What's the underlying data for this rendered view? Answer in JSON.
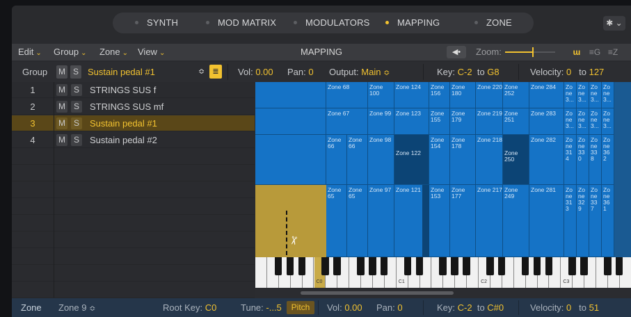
{
  "tabs": [
    {
      "label": "SYNTH",
      "active": false
    },
    {
      "label": "MOD MATRIX",
      "active": false
    },
    {
      "label": "MODULATORS",
      "active": false
    },
    {
      "label": "MAPPING",
      "active": true
    },
    {
      "label": "ZONE",
      "active": false
    }
  ],
  "gear_icon": "gear-icon",
  "menubar": {
    "edit": "Edit",
    "group": "Group",
    "zone": "Zone",
    "view": "View",
    "title": "MAPPING",
    "zoom_label": "Zoom:",
    "zoom_level": 0.55
  },
  "group_row": {
    "label": "Group",
    "m": "M",
    "s": "S",
    "selected": "Sustain pedal #1",
    "vol_label": "Vol:",
    "vol": "0.00",
    "pan_label": "Pan:",
    "pan": "0",
    "output_label": "Output:",
    "output": "Main",
    "key_label": "Key:",
    "key_low": "C-2",
    "key_to": "to",
    "key_high": "G8",
    "vel_label": "Velocity:",
    "vel_low": "0",
    "vel_to": "to",
    "vel_high": "127"
  },
  "groups": [
    {
      "num": "1",
      "name": "STRINGS SUS f"
    },
    {
      "num": "2",
      "name": "STRINGS SUS mf"
    },
    {
      "num": "3",
      "name": "Sustain pedal #1",
      "selected": true
    },
    {
      "num": "4",
      "name": "Sustain pedal #2"
    }
  ],
  "zones_row1": [
    {
      "w": 102,
      "label": ""
    },
    {
      "w": 60,
      "label": "Zone 68"
    },
    {
      "w": 38,
      "label": "Zone 100"
    },
    {
      "w": 50,
      "label": "Zone 124"
    },
    {
      "w": 30,
      "label": "Zone 156"
    },
    {
      "w": 37,
      "label": "Zone 180"
    },
    {
      "w": 39,
      "label": "Zone 220"
    },
    {
      "w": 38,
      "label": "Zone 252"
    },
    {
      "w": 50,
      "label": "Zone 284"
    },
    {
      "w": 18,
      "label": "Zo ne 3..."
    },
    {
      "w": 18,
      "label": "Zo ne 3..."
    },
    {
      "w": 18,
      "label": "Zo ne 3..."
    },
    {
      "w": 18,
      "label": "Zo ne 3..."
    }
  ],
  "zones_row2": [
    {
      "w": 102,
      "label": ""
    },
    {
      "w": 60,
      "label": "Zone 67"
    },
    {
      "w": 38,
      "label": "Zone 99"
    },
    {
      "w": 50,
      "label": "Zone 123"
    },
    {
      "w": 30,
      "label": "Zone 155"
    },
    {
      "w": 37,
      "label": "Zone 179"
    },
    {
      "w": 39,
      "label": "Zone 219"
    },
    {
      "w": 38,
      "label": "Zone 251"
    },
    {
      "w": 50,
      "label": "Zone 283"
    },
    {
      "w": 18,
      "label": "Zo ne 3..."
    },
    {
      "w": 18,
      "label": "Zo ne 3..."
    },
    {
      "w": 18,
      "label": "Zo ne 3..."
    },
    {
      "w": 18,
      "label": "Zo ne 3..."
    }
  ],
  "zones_row3": [
    {
      "w": 102,
      "label": ""
    },
    {
      "w": 30,
      "label": "Zone 66"
    },
    {
      "w": 30,
      "label": "Zone 66"
    },
    {
      "w": 38,
      "label": "Zone 98"
    },
    {
      "w": 50,
      "label": "Zone 122",
      "dark": true
    },
    {
      "w": 30,
      "label": "Zone 154"
    },
    {
      "w": 37,
      "label": "Zone 178"
    },
    {
      "w": 39,
      "label": "Zone 218"
    },
    {
      "w": 38,
      "label": "Zone 250",
      "dark": true
    },
    {
      "w": 50,
      "label": "Zone 282"
    },
    {
      "w": 18,
      "label": "Zo ne 31 4"
    },
    {
      "w": 18,
      "label": "Zo ne 33 0"
    },
    {
      "w": 18,
      "label": "Zo ne 33 8"
    },
    {
      "w": 18,
      "label": "Zo ne 36 2"
    }
  ],
  "zones_row4": [
    {
      "w": 102,
      "label": ""
    },
    {
      "w": 30,
      "label": "Zone 65"
    },
    {
      "w": 30,
      "label": "Zone 65"
    },
    {
      "w": 38,
      "label": "Zone 97"
    },
    {
      "w": 50,
      "label": "Zone 121"
    },
    {
      "w": 30,
      "label": "Zone 153"
    },
    {
      "w": 37,
      "label": "Zone 177"
    },
    {
      "w": 39,
      "label": "Zone 217"
    },
    {
      "w": 38,
      "label": "Zone 249"
    },
    {
      "w": 50,
      "label": "Zone 281"
    },
    {
      "w": 18,
      "label": "Zo ne 31 3"
    },
    {
      "w": 18,
      "label": "Zo ne 32 9"
    },
    {
      "w": 18,
      "label": "Zo ne 33 7"
    },
    {
      "w": 18,
      "label": "Zo ne 36 1"
    }
  ],
  "octave_labels": [
    "C0",
    "C1",
    "C2",
    "C3"
  ],
  "zone_bar": {
    "label": "Zone",
    "selected": "Zone 9",
    "root_label": "Root Key:",
    "root": "C0",
    "tune_label": "Tune:",
    "tune": "-...5",
    "pitch": "Pitch",
    "vol_label": "Vol:",
    "vol": "0.00",
    "pan_label": "Pan:",
    "pan": "0",
    "key_label": "Key:",
    "key_low": "C-2",
    "key_to": "to",
    "key_high": "C#0",
    "vel_label": "Velocity:",
    "vel_low": "0",
    "vel_to": "to",
    "vel_high": "51"
  }
}
